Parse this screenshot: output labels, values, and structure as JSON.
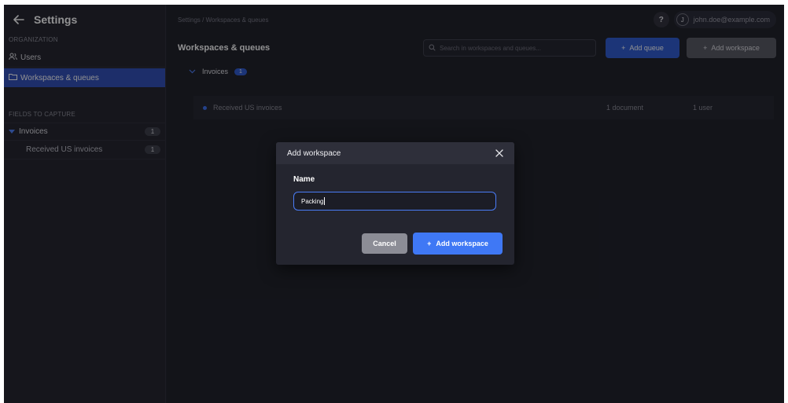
{
  "sidebar": {
    "title": "Settings",
    "section_organization": "ORGANIZATION",
    "users_label": "Users",
    "active_label": "Workspaces & queues",
    "section_fields": "FIELDS TO CAPTURE",
    "workspaces": [
      {
        "label": "Invoices",
        "count": "1"
      },
      {
        "label": "Received US invoices",
        "count": "1"
      }
    ]
  },
  "topbar": {
    "breadcrumb": "Settings / Workspaces & queues",
    "help": "?",
    "avatar_initial": "J",
    "user_email": "john.doe@example.com"
  },
  "toolbar": {
    "title": "Workspaces & queues",
    "search_placeholder": "Search in workspaces and queues...",
    "add_queue": "Add queue",
    "add_workspace": "Add workspace"
  },
  "workspace_list": {
    "name": "Invoices",
    "count": "1",
    "queue": {
      "name": "Received US invoices",
      "documents": "1 document",
      "users": "1 user"
    }
  },
  "modal": {
    "title": "Add workspace",
    "name_label": "Name",
    "name_value": "Packing",
    "cancel": "Cancel",
    "submit": "Add workspace"
  },
  "colors": {
    "accent": "#3f78f5",
    "sidebar_active": "#2c4bb7",
    "background": "#1b1c24"
  }
}
